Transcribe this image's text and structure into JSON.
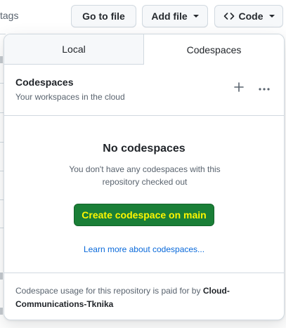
{
  "background": {
    "tags_text": "tags"
  },
  "toolbar": {
    "goto_file_label": "Go to file",
    "add_file_label": "Add file",
    "code_label": "Code"
  },
  "tabs": [
    {
      "label": "Local",
      "active": false
    },
    {
      "label": "Codespaces",
      "active": true
    }
  ],
  "codespaces": {
    "title": "Codespaces",
    "subtitle": "Your workspaces in the cloud",
    "empty_title": "No codespaces",
    "empty_desc": "You don't have any codespaces with this repository checked out",
    "create_button_label": "Create codespace on main",
    "learn_more_label": "Learn more about codespaces...",
    "footer_prefix": "Codespace usage for this repository is paid for by",
    "footer_owner": "Cloud-Communications-Tknika"
  },
  "colors": {
    "primary_button_bg": "#1a7f37",
    "primary_button_text": "#fff700",
    "link": "#0969da",
    "border": "#d1d9e0"
  },
  "icons": [
    "caret-down-icon",
    "code-icon",
    "plus-icon",
    "kebab-horizontal-icon"
  ]
}
